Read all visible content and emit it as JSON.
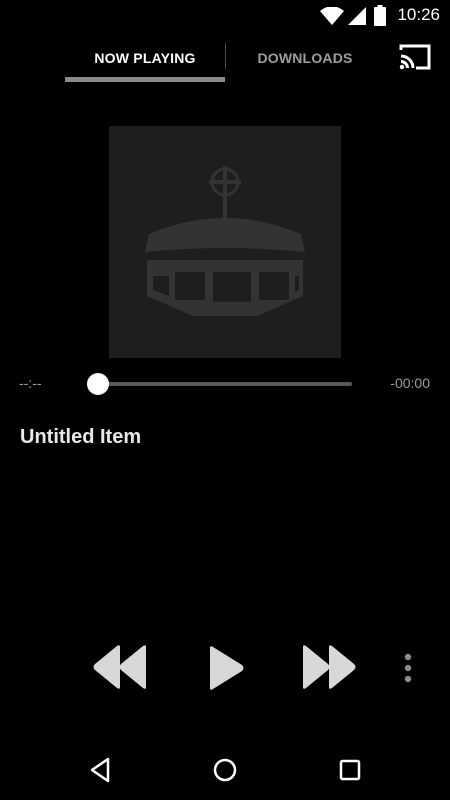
{
  "status_bar": {
    "time": "10:26",
    "icons": [
      "wifi-icon",
      "cell-signal-icon",
      "battery-icon"
    ]
  },
  "tabs": [
    {
      "label": "NOW PLAYING",
      "selected": true
    },
    {
      "label": "DOWNLOADS",
      "selected": false
    }
  ],
  "toolbar": {
    "cast_icon": "cast-icon"
  },
  "artwork": {
    "icon": "church-dome-icon"
  },
  "player": {
    "elapsed": "--:--",
    "remaining": "-00:00",
    "progress": 0,
    "title": "Untitled Item"
  },
  "controls": [
    "rewind-icon",
    "play-icon",
    "fast-forward-icon",
    "more-vert-icon"
  ],
  "nav_bar": [
    "back-icon",
    "home-icon",
    "recents-icon"
  ],
  "colors": {
    "background": "#000000",
    "tab_indicator": "#8a8a8a",
    "inactive_text": "#9e9e9e",
    "artwork_bg": "#1e1e1e",
    "artwork_icon": "#333333",
    "control_icon": "#d8d8d8"
  }
}
